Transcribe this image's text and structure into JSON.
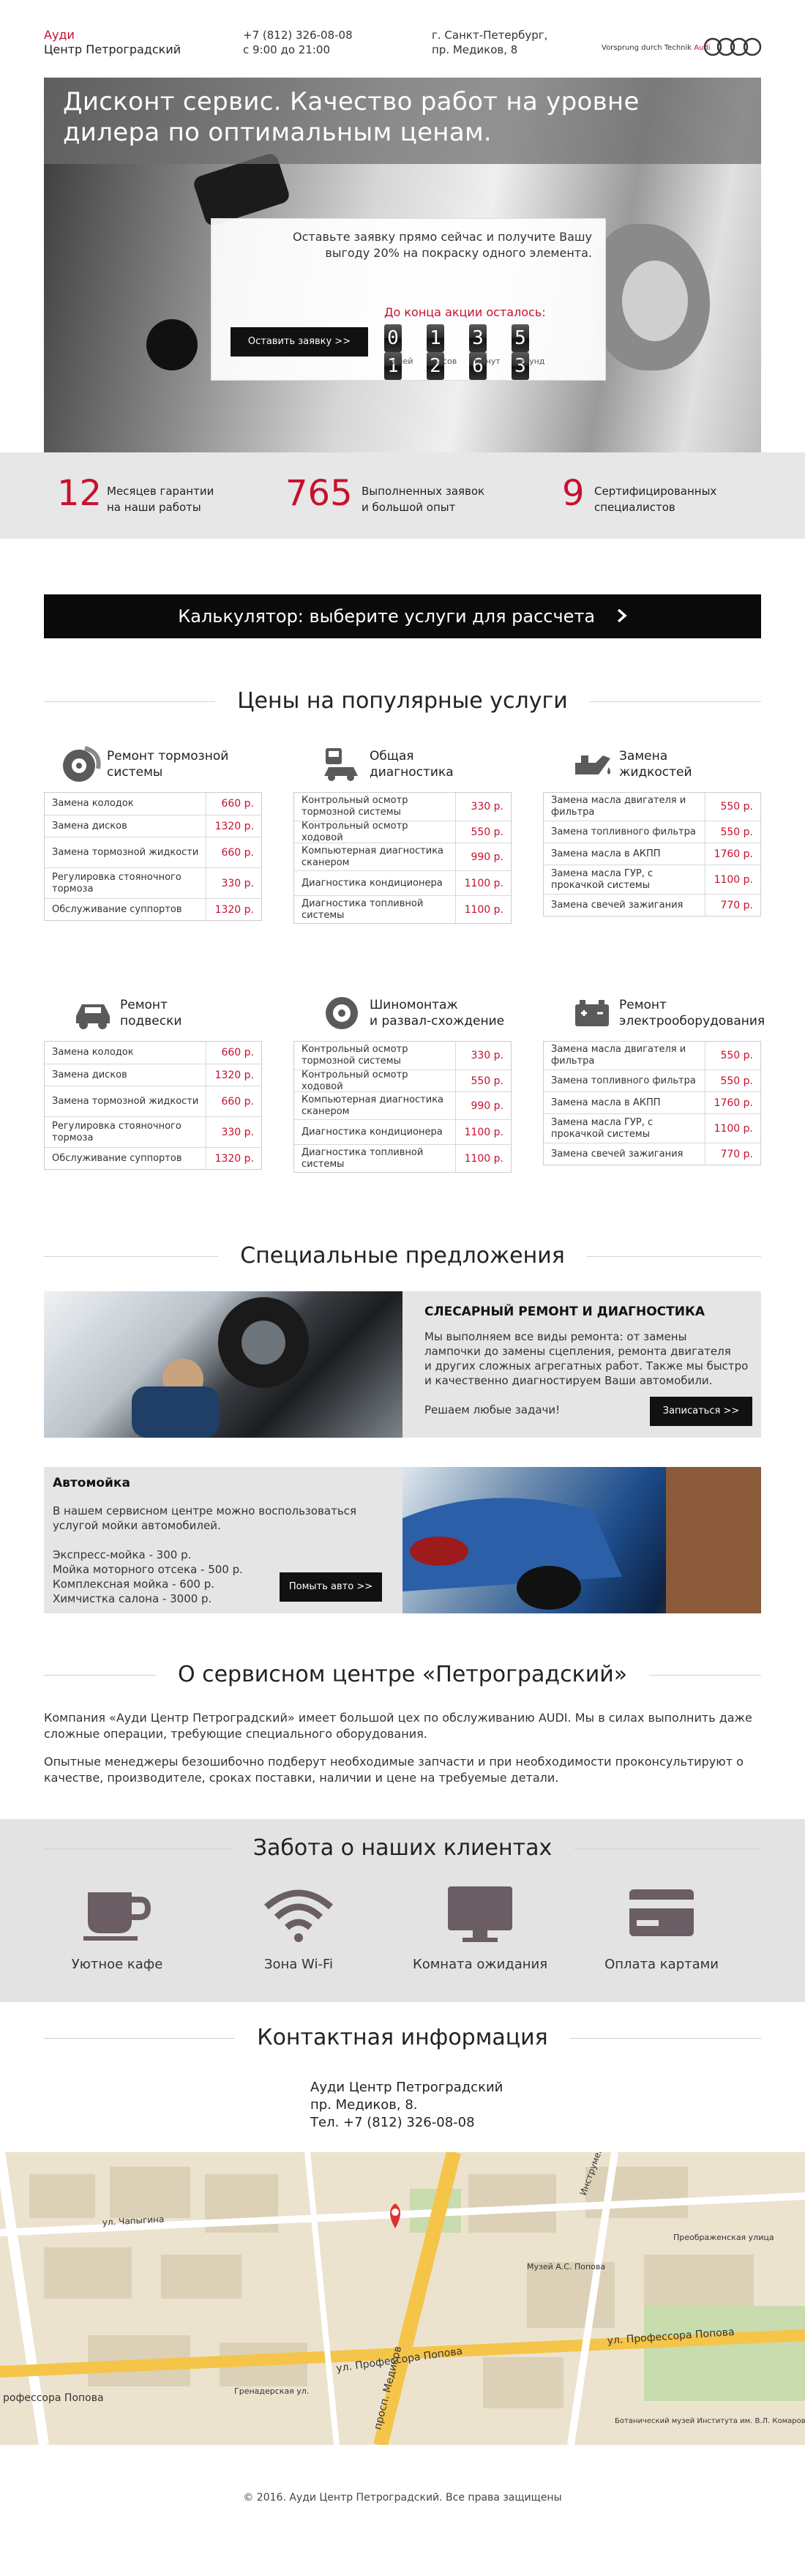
{
  "header": {
    "brand_line1": "Ауди",
    "brand_line2": "Центр Петроградский",
    "phone": "+7 (812) 326-08-08",
    "hours": "с 9:00 до 21:00",
    "city": "г. Санкт-Петербург,",
    "street": "пр. Медиков, 8",
    "slogan": "Vorsprung durch Technik",
    "logo_word": "Audi"
  },
  "hero": {
    "title_line1": "Дисконт сервис. Качество работ на уровне",
    "title_line2": "дилера по оптимальным ценам.",
    "promo_line1": "Оставьте заявку прямо сейчас и получите Вашу",
    "promo_line2": "выгоду 20% на покраску одного элемента.",
    "countdown_label": "До конца акции осталось:",
    "countdown": {
      "days": [
        "0",
        "1"
      ],
      "hours": [
        "1",
        "2"
      ],
      "minutes": [
        "3",
        "6"
      ],
      "seconds": [
        "5",
        "3"
      ],
      "days_label": "дней",
      "hours_label": "часов",
      "minutes_label": "минут",
      "seconds_label": "секунд"
    },
    "cta": "Оставить заявку >>"
  },
  "stats": [
    {
      "num": "12",
      "line1": "Месяцев гарантии",
      "line2": "на наши работы"
    },
    {
      "num": "765",
      "line1": "Выполненных заявок",
      "line2": "и большой опыт"
    },
    {
      "num": "9",
      "line1": "Сертифицированных",
      "line2": "специалистов"
    }
  ],
  "calculator_label": "Калькулятор: выберите услуги для рассчета",
  "prices_title": "Цены на популярные услуги",
  "services": [
    {
      "icon": "brake-disc-icon",
      "title1": "Ремонт тормозной",
      "title2": "системы",
      "rows": [
        {
          "name": "Замена колодок",
          "price": "660 р."
        },
        {
          "name": "Замена дисков",
          "price": "1320 р."
        },
        {
          "name": "Замена тормозной жидкости",
          "price": "660 р."
        },
        {
          "name": "Регулировка стояночного тормоза",
          "price": "330 р."
        },
        {
          "name": "Обслуживание суппортов",
          "price": "1320 р."
        }
      ]
    },
    {
      "icon": "car-diagnostics-icon",
      "title1": "Общая",
      "title2": "диагностика",
      "rows": [
        {
          "name": "Контрольный осмотр тормозной системы",
          "price": "330 р."
        },
        {
          "name": "Контрольный осмотр ходовой",
          "price": "550 р."
        },
        {
          "name": "Компьютерная диагностика сканером",
          "price": "990 р."
        },
        {
          "name": "Диагностика кондиционера",
          "price": "1100 р."
        },
        {
          "name": "Диагностика топливной системы",
          "price": "1100 р."
        }
      ]
    },
    {
      "icon": "oil-can-icon",
      "title1": "Замена",
      "title2": "жидкостей",
      "rows": [
        {
          "name": "Замена масла двигателя и фильтра",
          "price": "550 р."
        },
        {
          "name": "Замена топливного фильтра",
          "price": "550 р."
        },
        {
          "name": "Замена масла в АКПП",
          "price": "1760 р."
        },
        {
          "name": "Замена масла ГУР, с прокачкой системы",
          "price": "1100 р."
        },
        {
          "name": "Замена свечей зажигания",
          "price": "770 р."
        }
      ]
    },
    {
      "icon": "car-suspension-icon",
      "title1": "Ремонт",
      "title2": "подвески",
      "rows": [
        {
          "name": "Замена колодок",
          "price": "660 р."
        },
        {
          "name": "Замена дисков",
          "price": "1320 р."
        },
        {
          "name": "Замена тормозной жидкости",
          "price": "660 р."
        },
        {
          "name": "Регулировка стояночного тормоза",
          "price": "330 р."
        },
        {
          "name": "Обслуживание суппортов",
          "price": "1320 р."
        }
      ]
    },
    {
      "icon": "tire-icon",
      "title1": "Шиномонтаж",
      "title2": "и развал-схождение",
      "rows": [
        {
          "name": "Контрольный осмотр тормозной системы",
          "price": "330 р."
        },
        {
          "name": "Контрольный осмотр ходовой",
          "price": "550 р."
        },
        {
          "name": "Компьютерная диагностика сканером",
          "price": "990 р."
        },
        {
          "name": "Диагностика кондиционера",
          "price": "1100 р."
        },
        {
          "name": "Диагностика топливной системы",
          "price": "1100 р."
        }
      ]
    },
    {
      "icon": "car-battery-icon",
      "title1": "Ремонт",
      "title2": "электрооборудования",
      "rows": [
        {
          "name": "Замена масла двигателя и фильтра",
          "price": "550 р."
        },
        {
          "name": "Замена топливного фильтра",
          "price": "550 р."
        },
        {
          "name": "Замена масла в АКПП",
          "price": "1760 р."
        },
        {
          "name": "Замена масла ГУР, с прокачкой системы",
          "price": "1100 р."
        },
        {
          "name": "Замена свечей зажигания",
          "price": "770 р."
        }
      ]
    }
  ],
  "specials_title": "Специальные предложения",
  "offer1": {
    "title": "СЛЕСАРНЫЙ РЕМОНТ И ДИАГНОСТИКА",
    "text1": "Мы выполняем все виды ремонта: от замены",
    "text2": "лампочки до замены сцепления, ремонта двигателя",
    "text3": "и других сложных агрегатных работ. Также мы быстро",
    "text4": "и качественно диагностируем Ваши автомобили.",
    "text5": "Решаем любые задачи!",
    "button": "Записаться >>"
  },
  "offer2": {
    "title": "Автомойка",
    "text1": "В нашем сервисном центре можно воспользоваться",
    "text2": "услугой мойки автомобилей.",
    "list1": "Экспресс-мойка - 300 р.",
    "list2": "Мойка моторного отсека - 500 р.",
    "list3": "Комплексная мойка - 600 р.",
    "list4": "Химчистка салона - 3000 р.",
    "button": "Помыть авто >>"
  },
  "about_title": "О сервисном центре «Петроградский»",
  "about_p1": "Компания «Ауди Центр Петроградский» имеет большой цех по обслуживанию AUDI. Мы в силах выполнить даже сложные операции, требующие специального оборудования.",
  "about_p2": "Опытные менеджеры безошибочно подберут необходимые запчасти и при необходимости проконсультируют о качестве, производителе, сроках поставки, наличии и цене на требуемые детали.",
  "care_title": "Забота о наших клиентах",
  "care": [
    {
      "icon": "coffee-cup-icon",
      "label": "Уютное кафе"
    },
    {
      "icon": "wifi-icon",
      "label": "Зона Wi-Fi"
    },
    {
      "icon": "monitor-icon",
      "label": "Комната ожидания"
    },
    {
      "icon": "credit-card-icon",
      "label": "Оплата картами"
    }
  ],
  "contacts_title": "Контактная информация",
  "contacts": {
    "line1": "Ауди Центр Петроградский",
    "line2": "пр. Медиков, 8.",
    "line3": "Тел. +7 (812) 326-08-08"
  },
  "map_labels": {
    "street1": "ул. Профессора Попова",
    "street2": "ул. Профессора Попова",
    "street3": "просп. Медиков",
    "street4": "ул. Чапыгина",
    "street5": "Инструментальная ул.",
    "street6": "Гренадерская ул.",
    "street7": "рофессора Попова",
    "place1": "Музей А.С. Попова",
    "place2": "Ботанический музей Института им. В.Л. Комарова",
    "place3": "Преображенская улица"
  },
  "footer": "© 2016. Ауди Центр Петроградский. Все права защищены",
  "colors": {
    "accent": "#c8102e",
    "dark": "#0a0a0a",
    "grey_band": "#e7e7e7"
  }
}
